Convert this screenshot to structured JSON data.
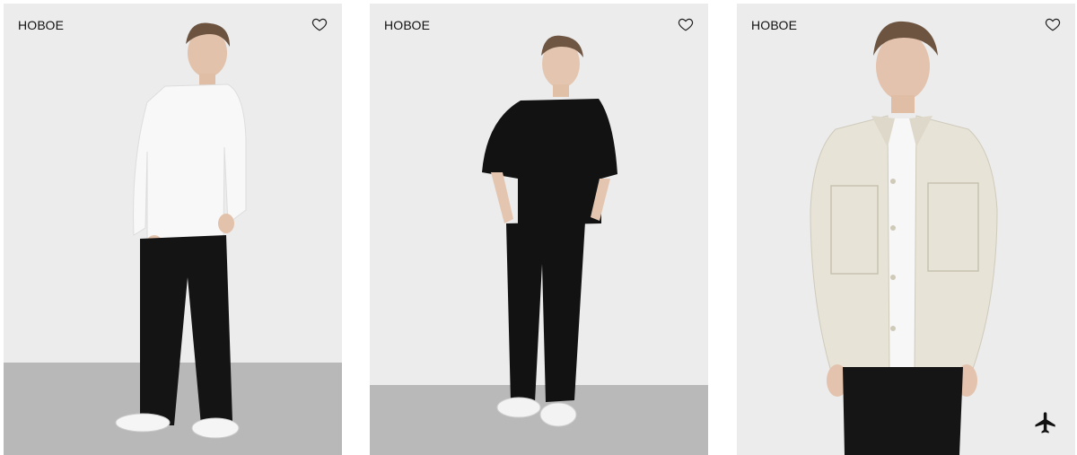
{
  "products": [
    {
      "badge": "НОВОЕ",
      "favorite_icon": "heart-outline-icon",
      "image": "model-white-longsleeve-black-trousers"
    },
    {
      "badge": "НОВОЕ",
      "favorite_icon": "heart-outline-icon",
      "image": "model-black-tshirt-black-trousers"
    },
    {
      "badge": "НОВОЕ",
      "favorite_icon": "heart-outline-icon",
      "image": "model-beige-overshirt-white-tee",
      "delivery_icon": "airplane-icon"
    }
  ],
  "colors": {
    "background": "#ffffff",
    "card_wall": "#ececec",
    "floor": "#b9b9b9",
    "text": "#111111"
  }
}
